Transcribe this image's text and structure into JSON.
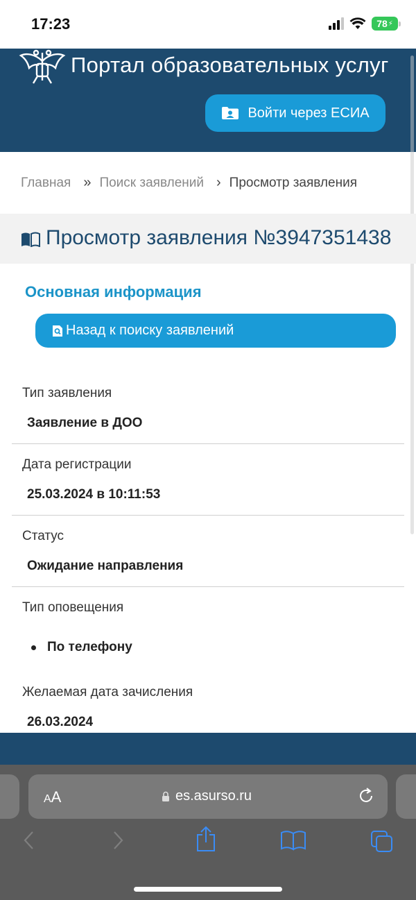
{
  "status_bar": {
    "time": "17:23",
    "battery": "78"
  },
  "header": {
    "portal_title": "Портал образовательных услуг",
    "esia_button": "Войти через ЕСИА"
  },
  "breadcrumb": {
    "items": [
      "Главная",
      "Поиск заявлений",
      "Просмотр заявления"
    ],
    "separators": [
      "»",
      "›"
    ]
  },
  "page": {
    "title": "Просмотр заявления №3947351438",
    "section_heading": "Основная информация",
    "back_button": "Назад к поиску заявлений"
  },
  "info": {
    "rows": [
      {
        "label": "Тип заявления",
        "value": "Заявление в ДОО"
      },
      {
        "label": "Дата регистрации",
        "value": "25.03.2024 в 10:11:53"
      },
      {
        "label": "Статус",
        "value": "Ожидание направления"
      },
      {
        "label": "Тип оповещения",
        "value": "По телефону"
      },
      {
        "label": "Желаемая дата зачисления",
        "value": "26.03.2024"
      }
    ]
  },
  "browser": {
    "aa_small": "A",
    "aa_large": "A",
    "url": "es.asurso.ru"
  },
  "colors": {
    "header_bg": "#1d4a6e",
    "accent": "#1a9bd7",
    "heading": "#1b94c8"
  }
}
